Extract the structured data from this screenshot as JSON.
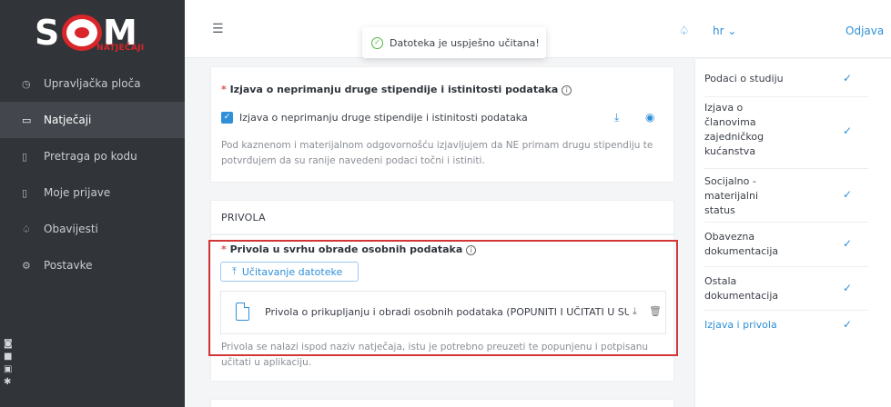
{
  "logo": {
    "letters_left": "S",
    "letters_right": "M",
    "subtitle": "NATJEČAJI"
  },
  "sidebar": {
    "items": [
      {
        "label": "Upravljačka ploča",
        "icon": "dashboard-icon",
        "glyph": "◷"
      },
      {
        "label": "Natječaji",
        "icon": "folder-icon",
        "glyph": "▭",
        "active": true
      },
      {
        "label": "Pretraga po kodu",
        "icon": "document-icon",
        "glyph": "▯"
      },
      {
        "label": "Moje prijave",
        "icon": "file-list-icon",
        "glyph": "▯"
      },
      {
        "label": "Obavijesti",
        "icon": "bell-icon",
        "glyph": "♤"
      },
      {
        "label": "Postavke",
        "icon": "gear-icon",
        "glyph": "⚙"
      }
    ]
  },
  "header": {
    "lang": "hr ⌄",
    "logout": "Odjava"
  },
  "toast": {
    "message": "Datoteka je uspješno učitana!"
  },
  "section1": {
    "title": "Izjava o neprimanju druge stipendije i istinitosti podataka",
    "checkbox_label": "Izjava o neprimanju druge stipendije i istinitosti podataka",
    "description": "Pod kaznenom i materijalnom odgovornošću izjavljujem da NE primam drugu stipendiju te potvrđujem da su ranije navedeni podaci točni i istiniti."
  },
  "section2": {
    "title": "PRIVOLA"
  },
  "section3": {
    "title": "Privola u svrhu obrade osobnih podataka",
    "upload_label": "Učitavanje datoteke",
    "file_name": "Privola o prikupljanju i obradi osobnih podataka (POPUNITI I UČITATI U SUST...",
    "description": "Privola se nalazi ispod naziv natječaja, istu je potrebno preuzeti te popunjenu i potpisanu učitati u aplikaciju."
  },
  "steps": [
    {
      "label": "Podaci o studiju"
    },
    {
      "label": "Izjava o članovima zajedničkog kućanstva"
    },
    {
      "label": "Socijalno - materijalni status"
    },
    {
      "label": "Obavezna dokumentacija"
    },
    {
      "label": "Ostala dokumentacija"
    },
    {
      "label": "Izjava i privola",
      "active": true
    }
  ],
  "colors": {
    "accent": "#2f8fd8",
    "sidebar": "#313438",
    "required": "#e05050",
    "highlight": "#d23636",
    "success": "#4fb640"
  }
}
